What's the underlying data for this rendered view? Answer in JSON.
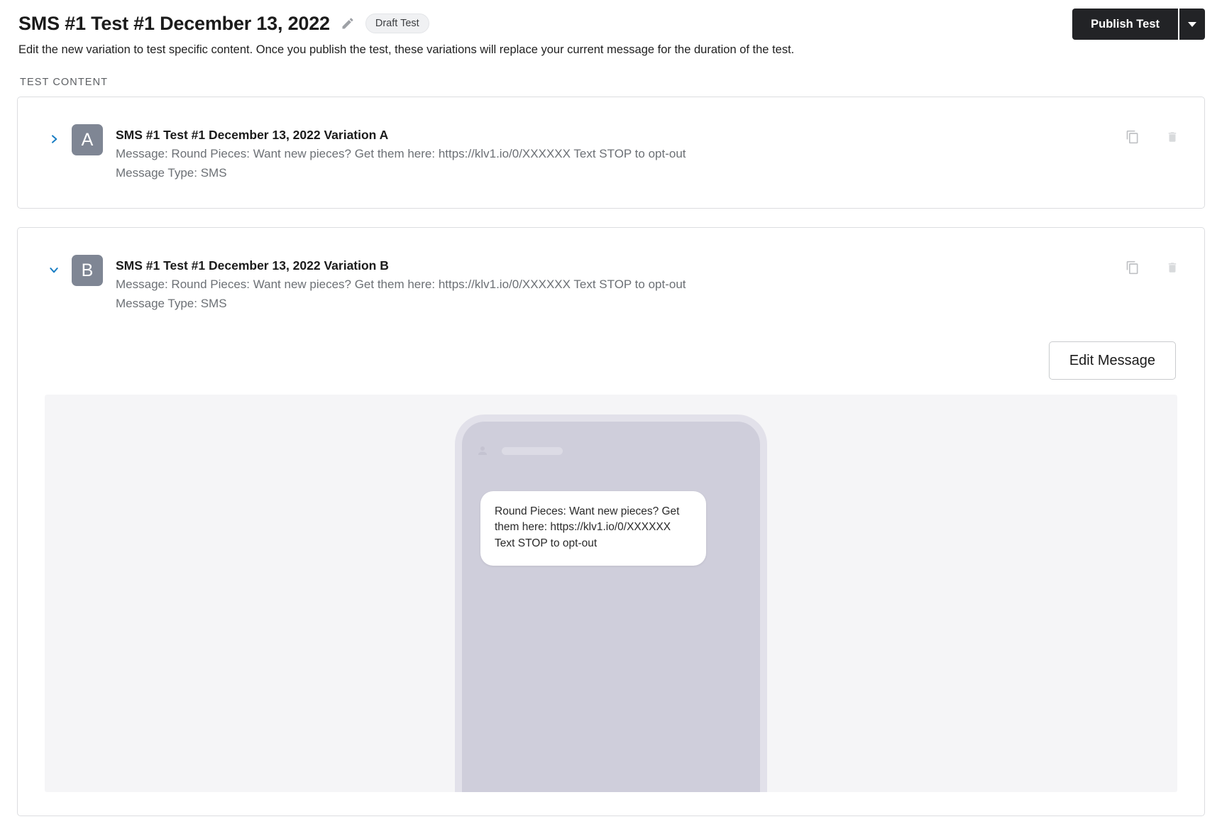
{
  "header": {
    "title": "SMS #1 Test #1 December 13, 2022",
    "edit_icon": "pencil-icon",
    "status_badge": "Draft Test",
    "subtitle": "Edit the new variation to test specific content. Once you publish the test, these variations will replace your current message for the duration of the test.",
    "publish_label": "Publish Test",
    "publish_caret_icon": "chevron-down-icon",
    "publish_bg_color": "#222326"
  },
  "section": {
    "label": "TEST CONTENT"
  },
  "variations": [
    {
      "letter": "A",
      "title": "SMS #1 Test #1 December 13, 2022 Variation A",
      "message_line": "Message: Round Pieces: Want new pieces? Get them here: https://klv1.io/0/XXXXXX Text STOP to opt-out",
      "type_line": "Message Type: SMS",
      "expanded": false,
      "chevron_icon": "chevron-right-icon",
      "duplicate_icon": "duplicate-icon",
      "delete_icon": "trash-icon"
    },
    {
      "letter": "B",
      "title": "SMS #1 Test #1 December 13, 2022 Variation B",
      "message_line": "Message: Round Pieces: Want new pieces? Get them here: https://klv1.io/0/XXXXXX Text STOP to opt-out",
      "type_line": "Message Type: SMS",
      "expanded": true,
      "chevron_icon": "chevron-down-icon",
      "duplicate_icon": "duplicate-icon",
      "delete_icon": "trash-icon",
      "edit_message_label": "Edit Message",
      "preview": {
        "bubble_text": "Round Pieces: Want new pieces? Get them here: https://klv1.io/0/XXXXXX Text STOP to opt-out",
        "phone_body_color": "#cfcedb",
        "panel_bg_color": "#f5f5f7"
      }
    }
  ],
  "colors": {
    "chevron_blue": "#1a7ec4",
    "badge_gray": "#7f8694",
    "muted_text": "#6c7075"
  }
}
